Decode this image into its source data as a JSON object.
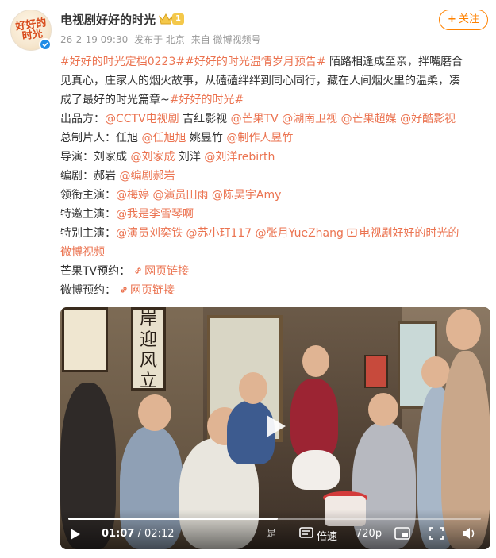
{
  "account": {
    "name": "电视剧好好的时光",
    "level": "1",
    "avatar_text": "好好的时光",
    "verified": true
  },
  "meta": {
    "time": "26-2-19 09:30",
    "location": "发布于 北京",
    "source": "来自 微博视频号"
  },
  "follow_button": {
    "label": "关注"
  },
  "post": {
    "intro_lines": [
      [
        {
          "t": "#好好的时光定档0223#",
          "link": true
        },
        {
          "t": "#好好的时光温情岁月预告#",
          "link": true
        },
        {
          "t": " 陌路相逢成至亲，拌嘴磨合",
          "link": false
        }
      ],
      [
        {
          "t": "见真心，庄家人的烟火故事，从磕磕绊绊到同心同行，藏在人间烟火里的温柔，凑",
          "link": false
        }
      ],
      [
        {
          "t": "成了最好的时光篇章~",
          "link": false
        },
        {
          "t": "#好好的时光#",
          "link": true
        }
      ]
    ],
    "credits": [
      {
        "label": "出品方：",
        "items": [
          {
            "t": "@CCTV电视剧",
            "link": true
          },
          {
            "t": " 吉红影视 ",
            "link": false
          },
          {
            "t": "@芒果TV",
            "link": true
          },
          {
            "t": " ",
            "link": false
          },
          {
            "t": "@湖南卫视",
            "link": true
          },
          {
            "t": " ",
            "link": false
          },
          {
            "t": "@芒果超媒",
            "link": true
          },
          {
            "t": " ",
            "link": false
          },
          {
            "t": "@好酷影视",
            "link": true
          }
        ]
      },
      {
        "label": "总制片人：",
        "items": [
          {
            "t": "任旭 ",
            "link": false
          },
          {
            "t": "@任旭旭",
            "link": true
          },
          {
            "t": " 姚昱竹 ",
            "link": false
          },
          {
            "t": "@制作人昱竹",
            "link": true
          }
        ]
      },
      {
        "label": "导演：",
        "items": [
          {
            "t": "刘家成 ",
            "link": false
          },
          {
            "t": "@刘家成",
            "link": true
          },
          {
            "t": " 刘洋 ",
            "link": false
          },
          {
            "t": "@刘洋rebirth",
            "link": true
          }
        ]
      },
      {
        "label": "编剧：",
        "items": [
          {
            "t": "郝岩 ",
            "link": false
          },
          {
            "t": "@编剧郝岩",
            "link": true
          }
        ]
      },
      {
        "label": "领衔主演：",
        "items": [
          {
            "t": "@梅婷",
            "link": true
          },
          {
            "t": " ",
            "link": false
          },
          {
            "t": "@演员田雨",
            "link": true
          },
          {
            "t": " ",
            "link": false
          },
          {
            "t": "@陈昊宇Amy",
            "link": true
          }
        ]
      },
      {
        "label": "特邀主演：",
        "items": [
          {
            "t": "@我是李雪琴啊",
            "link": true
          }
        ]
      },
      {
        "label": "特别主演：",
        "items": [
          {
            "t": "@演员刘奕铁",
            "link": true
          },
          {
            "t": " ",
            "link": false
          },
          {
            "t": "@苏小玎117",
            "link": true
          },
          {
            "t": " ",
            "link": false
          },
          {
            "t": "@张月YueZhang",
            "link": true
          },
          {
            "t": " ",
            "link": false
          },
          {
            "t": "电视剧好好的时光的",
            "link": true
          }
        ]
      },
      {
        "label": "",
        "items": [
          {
            "t": "微博视频",
            "link": true
          }
        ]
      },
      {
        "label": "芒果TV预约：",
        "items": [
          {
            "t": "网页链接",
            "link": true,
            "icon": "link-icon"
          }
        ]
      },
      {
        "label": "微博预约：",
        "items": [
          {
            "t": "网页链接",
            "link": true,
            "icon": "link-icon"
          }
        ]
      }
    ]
  },
  "video": {
    "scroll_text": [
      "岸",
      "迎",
      "风",
      "立"
    ],
    "current_time": "01:07",
    "total_time": "02:12",
    "time_separator": " / ",
    "progress": 0.508,
    "speed_label": "倍速",
    "quality_label": "720p",
    "watermark": "是"
  },
  "colors": {
    "link": "#eb7350",
    "follow": "#ff8200",
    "text": "#333333",
    "meta": "#999999",
    "verified": "#1f8ce6"
  }
}
